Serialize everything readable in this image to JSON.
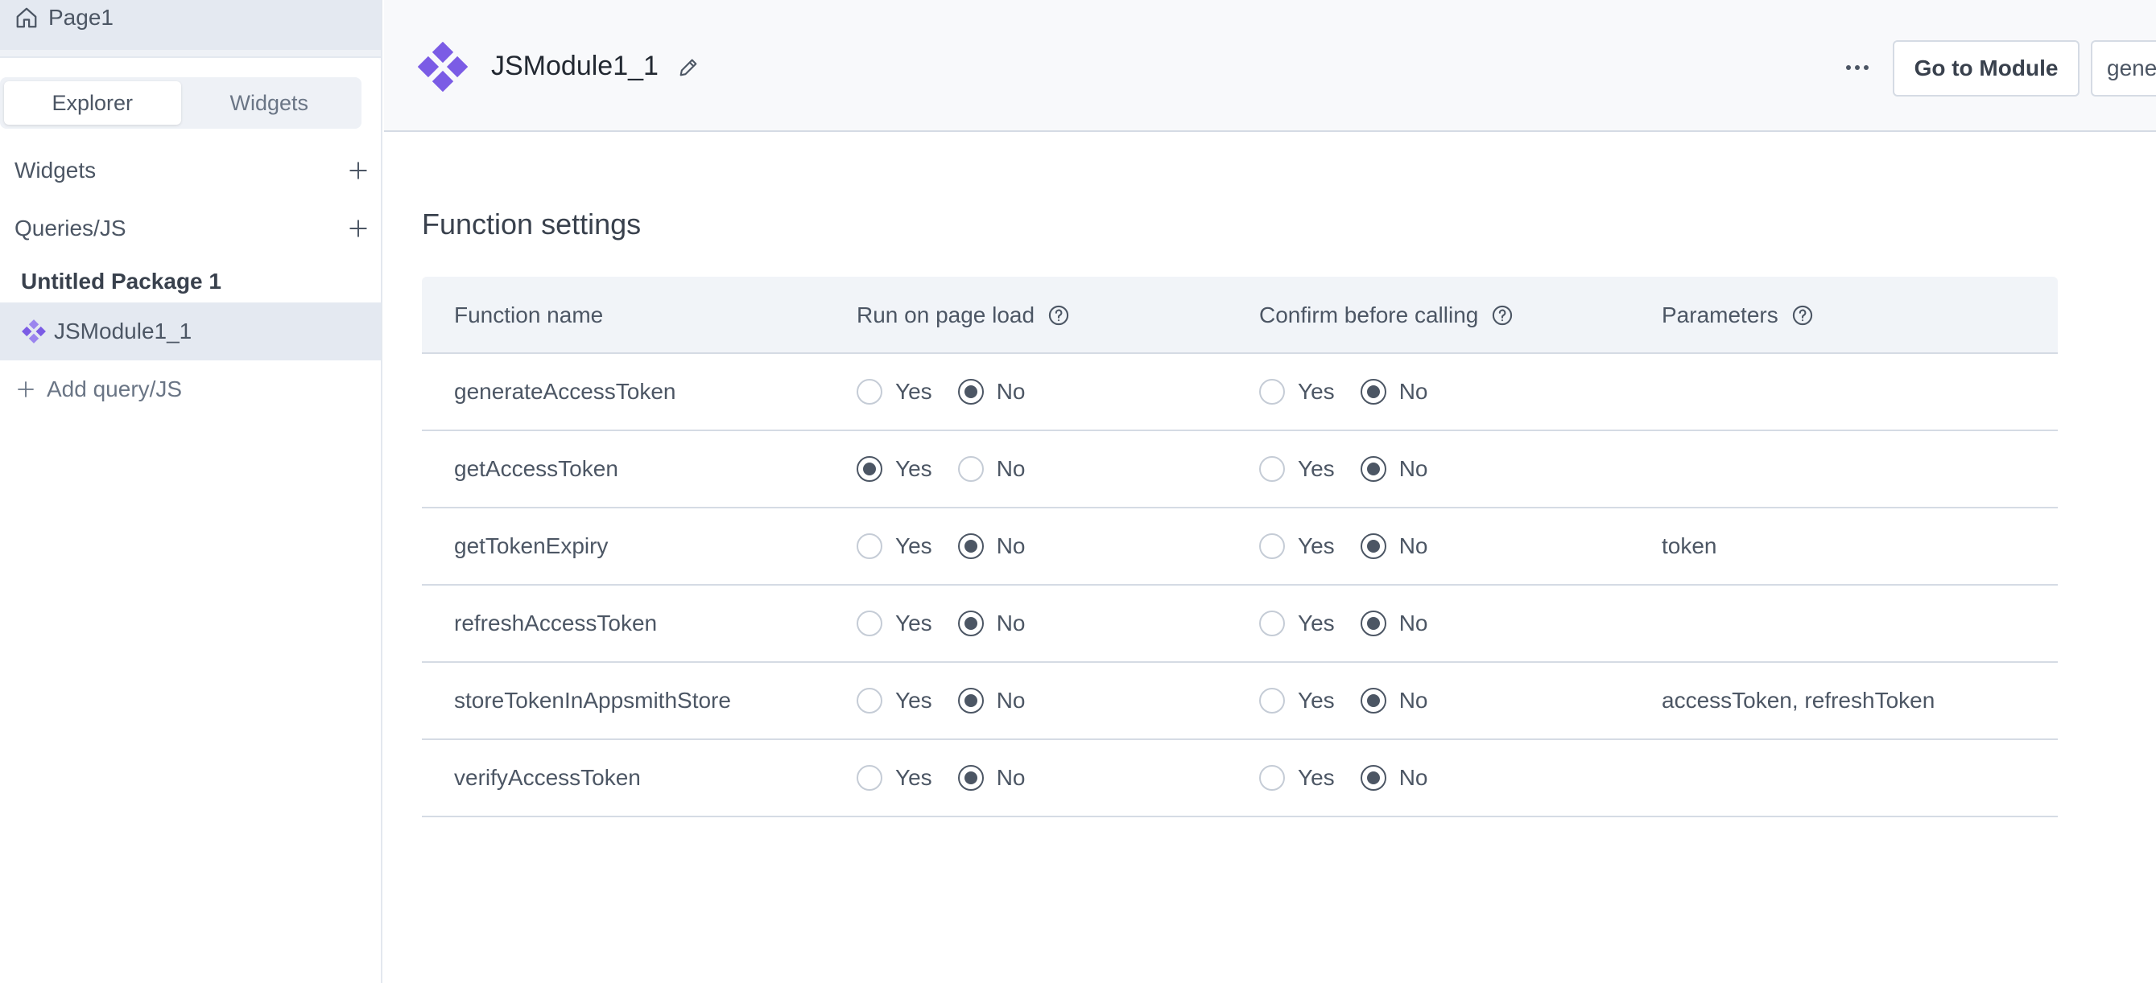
{
  "sidebar": {
    "page_label": "Page1",
    "tabs": [
      {
        "label": "Explorer",
        "active": true
      },
      {
        "label": "Widgets",
        "active": false
      }
    ],
    "sections": {
      "widgets_label": "Widgets",
      "queries_label": "Queries/JS"
    },
    "package_name": "Untitled Package 1",
    "module_item_label": "JSModule1_1",
    "add_label": "Add query/JS"
  },
  "header": {
    "module_title": "JSModule1_1",
    "go_to_module_label": "Go to Module",
    "select_value": "gene",
    "accent_color": "#7b5ce5"
  },
  "main": {
    "title": "Function settings",
    "columns": {
      "function_name": "Function name",
      "run_on_page_load": "Run on page load",
      "confirm_before_calling": "Confirm before calling",
      "parameters": "Parameters"
    },
    "option_yes": "Yes",
    "option_no": "No",
    "rows": [
      {
        "name": "generateAccessToken",
        "run_on_page_load": "No",
        "confirm_before_calling": "No",
        "parameters": ""
      },
      {
        "name": "getAccessToken",
        "run_on_page_load": "Yes",
        "confirm_before_calling": "No",
        "parameters": ""
      },
      {
        "name": "getTokenExpiry",
        "run_on_page_load": "No",
        "confirm_before_calling": "No",
        "parameters": "token"
      },
      {
        "name": "refreshAccessToken",
        "run_on_page_load": "No",
        "confirm_before_calling": "No",
        "parameters": ""
      },
      {
        "name": "storeTokenInAppsmithStore",
        "run_on_page_load": "No",
        "confirm_before_calling": "No",
        "parameters": "accessToken, refreshToken"
      },
      {
        "name": "verifyAccessToken",
        "run_on_page_load": "No",
        "confirm_before_calling": "No",
        "parameters": ""
      }
    ]
  }
}
